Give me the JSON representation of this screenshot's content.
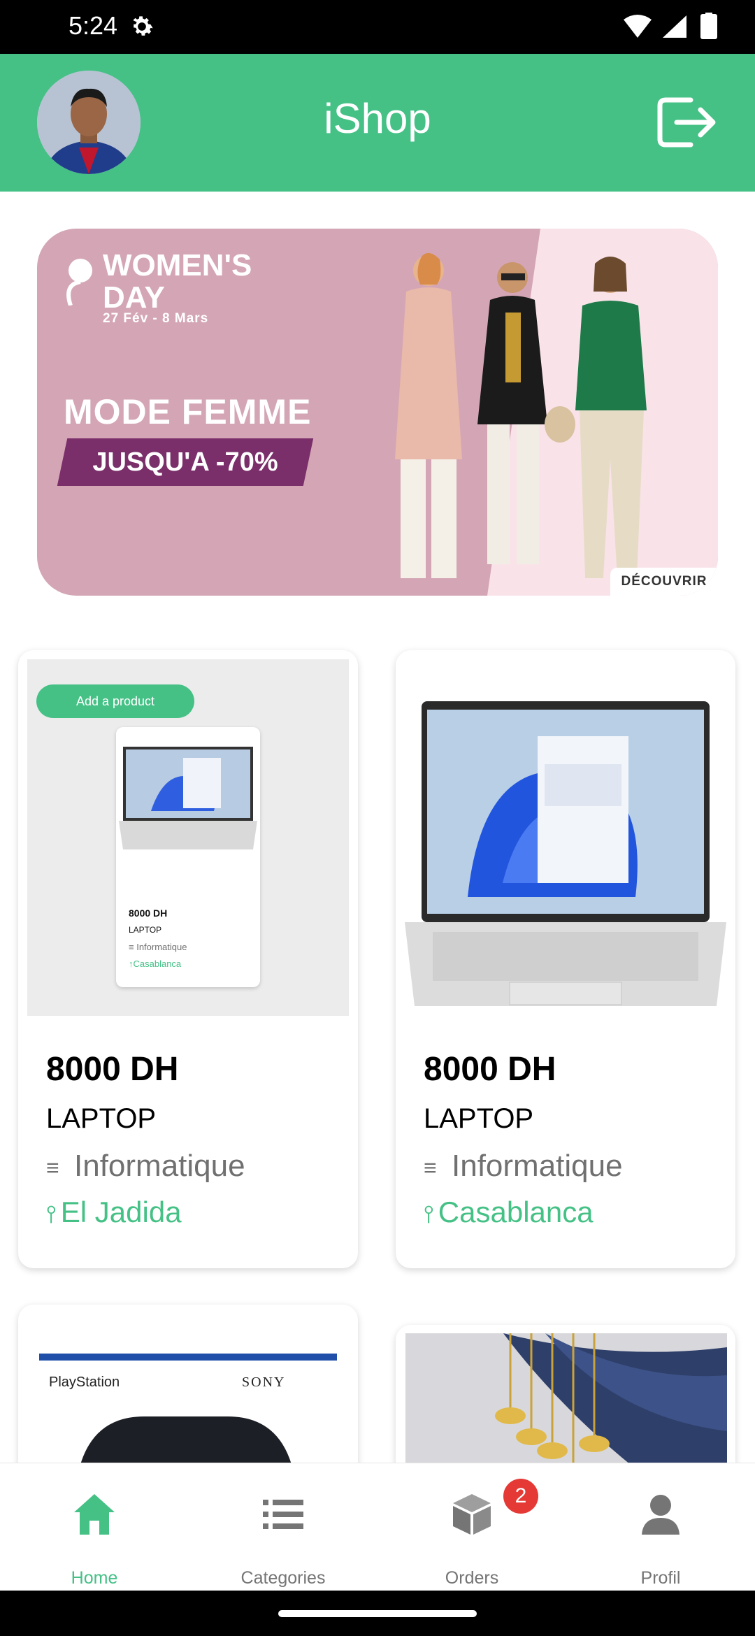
{
  "status_bar": {
    "time": "5:24"
  },
  "app_bar": {
    "title": "iShop"
  },
  "banner": {
    "headline": "WOMEN'S DAY",
    "dates": "27 Fév - 8 Mars",
    "title": "MODE FEMME",
    "discount": "JUSQU'A -70%",
    "cta": "DÉCOUVRIR"
  },
  "products": [
    {
      "price": "8000 DH",
      "name": "LAPTOP",
      "category": "Informatique",
      "city": "El Jadida",
      "preview": {
        "button": "Add a product",
        "price": "8000 DH",
        "name": "LAPTOP",
        "category": "Informatique",
        "city": "Casablanca"
      }
    },
    {
      "price": "8000 DH",
      "name": "LAPTOP",
      "category": "Informatique",
      "city": "Casablanca"
    },
    {
      "brand_left": "PlayStation",
      "brand_right": "SONY"
    },
    {}
  ],
  "bottom_nav": {
    "items": [
      {
        "label": "Home",
        "active": true
      },
      {
        "label": "Categories",
        "active": false
      },
      {
        "label": "Orders",
        "active": false,
        "badge": "2"
      },
      {
        "label": "Profil",
        "active": false
      }
    ]
  },
  "colors": {
    "primary": "#45c186",
    "badge": "#e53935",
    "inactive": "#757575"
  }
}
